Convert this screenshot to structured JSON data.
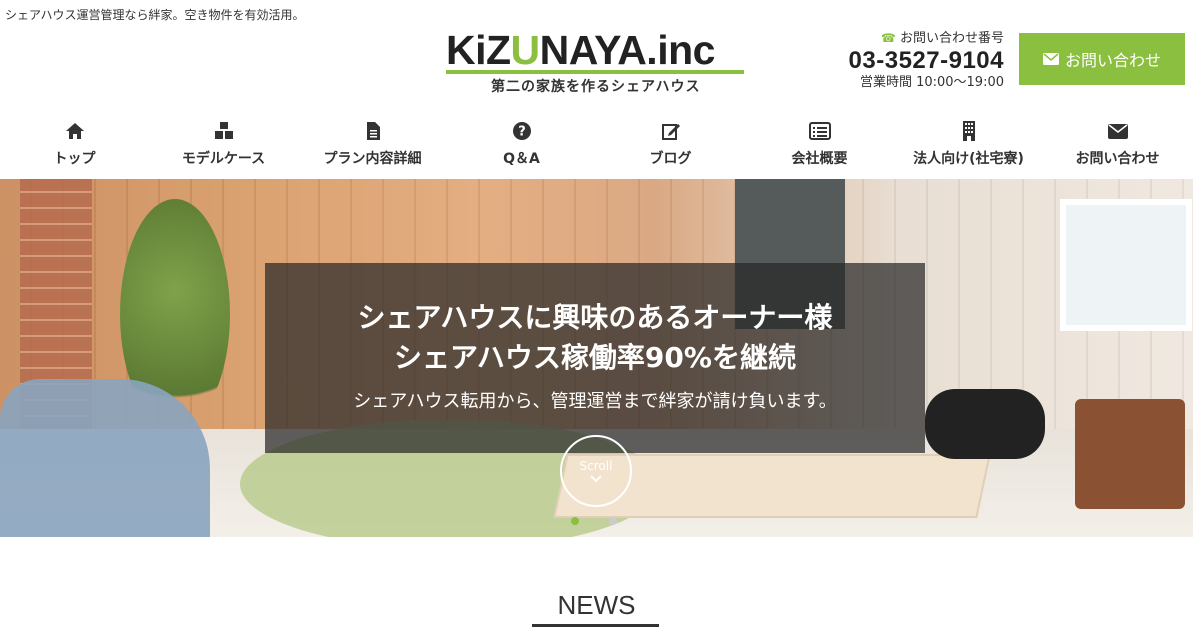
{
  "tagline": "シェアハウス運営管理なら絆家。空き物件を有効活用。",
  "logo": {
    "text_main": "KiZUNAYA.inc",
    "sub": "第二の家族を作るシェアハウス",
    "accent": "#8bbf3f"
  },
  "contact": {
    "label": "お問い合わせ番号",
    "phone": "03-3527-9104",
    "hours": "営業時間 10:00〜19:00",
    "cta_label": "お問い合わせ"
  },
  "nav": {
    "items": [
      {
        "label": "トップ",
        "icon": "home-icon"
      },
      {
        "label": "モデルケース",
        "icon": "cubes-icon"
      },
      {
        "label": "プラン内容詳細",
        "icon": "document-icon"
      },
      {
        "label": "Q＆A",
        "icon": "question-icon"
      },
      {
        "label": "ブログ",
        "icon": "edit-icon"
      },
      {
        "label": "会社概要",
        "icon": "list-icon"
      },
      {
        "label": "法人向け(社宅寮)",
        "icon": "building-icon"
      },
      {
        "label": "お問い合わせ",
        "icon": "envelope-icon"
      }
    ]
  },
  "hero": {
    "title_line1": "シェアハウスに興味のあるオーナー様",
    "title_line2": "シェアハウス稼働率90%を継続",
    "subtitle": "シェアハウス転用から、管理運営まで絆家が請け負います。",
    "scroll_label": "Scroll"
  },
  "section": {
    "news_title": "NEWS"
  }
}
